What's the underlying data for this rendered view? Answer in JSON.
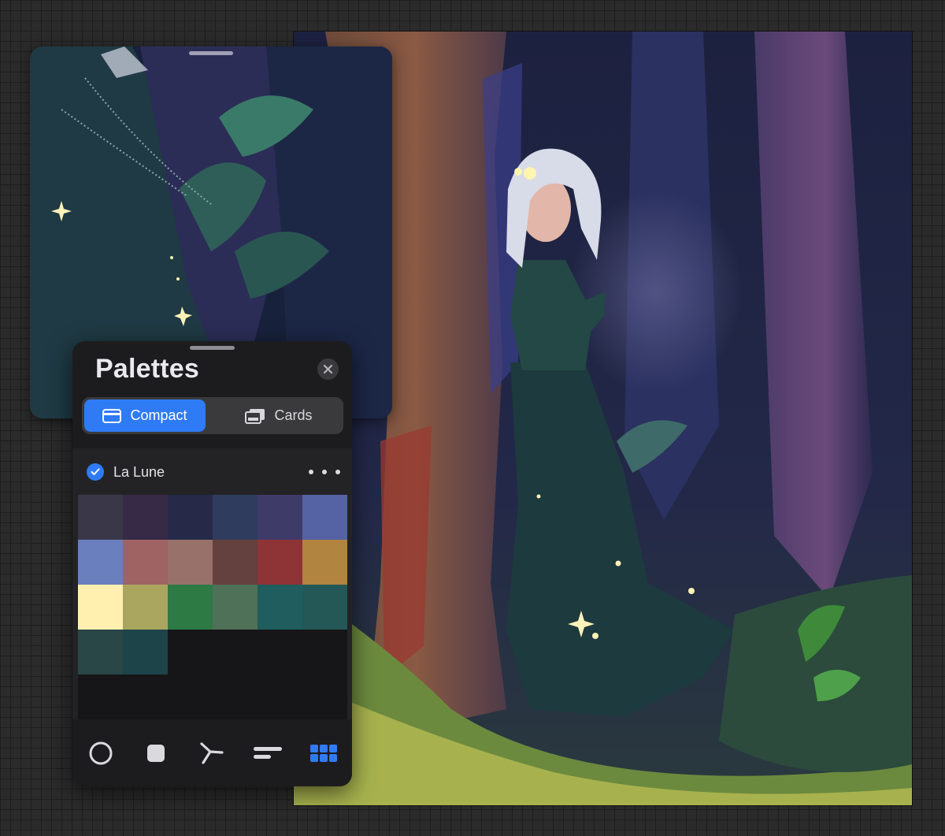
{
  "panel": {
    "title": "Palettes",
    "tabs": [
      {
        "label": "Compact",
        "active": true,
        "icon": "compact-view-icon"
      },
      {
        "label": "Cards",
        "active": false,
        "icon": "cards-view-icon"
      }
    ],
    "palette": {
      "name": "La Lune",
      "selected": true,
      "swatches": [
        "#3a3748",
        "#362a47",
        "#262a48",
        "#2f3c5e",
        "#3f3b69",
        "#5562a4",
        "#6a7fbe",
        "#9f6364",
        "#98716b",
        "#64403e",
        "#8e3336",
        "#b1843f",
        "#fff0b0",
        "#aaa65f",
        "#2d7a45",
        "#4f7157",
        "#1f5d5e",
        "#235856",
        "#284746",
        "#1d4449"
      ]
    },
    "toolbar": [
      {
        "name": "disc-tool",
        "active": false
      },
      {
        "name": "classic-tool",
        "active": false
      },
      {
        "name": "harmony-tool",
        "active": false
      },
      {
        "name": "value-tool",
        "active": false
      },
      {
        "name": "palettes-tool",
        "active": true
      }
    ]
  },
  "colors": {
    "accent": "#2f7bf5",
    "panel_bg": "#1c1c1e",
    "icon_inactive": "#d9d9de"
  }
}
